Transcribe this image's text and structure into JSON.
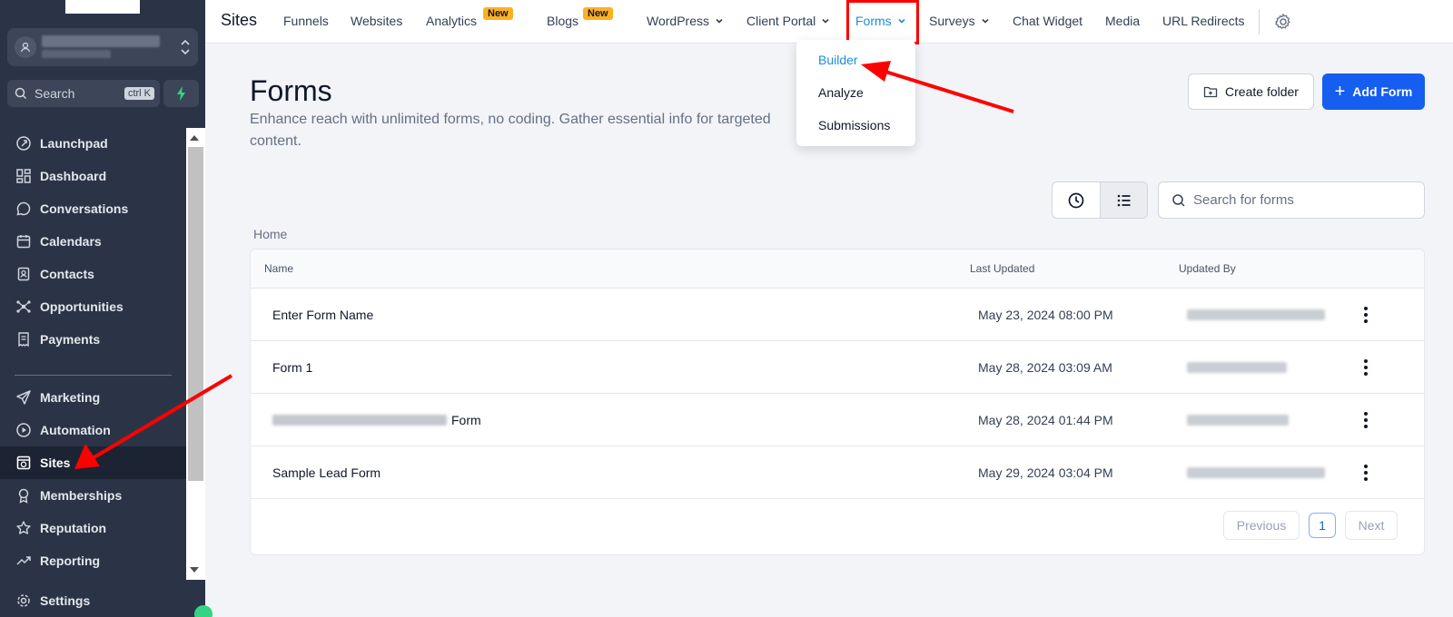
{
  "sidebar": {
    "search_label": "Search",
    "search_shortcut": "ctrl K",
    "items": [
      {
        "label": "Launchpad",
        "icon": "rocket-icon"
      },
      {
        "label": "Dashboard",
        "icon": "grid-icon"
      },
      {
        "label": "Conversations",
        "icon": "chat-bubble-icon"
      },
      {
        "label": "Calendars",
        "icon": "calendar-icon"
      },
      {
        "label": "Contacts",
        "icon": "contact-book-icon"
      },
      {
        "label": "Opportunities",
        "icon": "network-icon"
      },
      {
        "label": "Payments",
        "icon": "receipt-icon"
      },
      {
        "label": "Marketing",
        "icon": "send-icon"
      },
      {
        "label": "Automation",
        "icon": "play-circle-icon"
      },
      {
        "label": "Sites",
        "icon": "globe-window-icon"
      },
      {
        "label": "Memberships",
        "icon": "award-icon"
      },
      {
        "label": "Reputation",
        "icon": "star-icon"
      },
      {
        "label": "Reporting",
        "icon": "trend-up-icon"
      },
      {
        "label": "Settings",
        "icon": "gear-icon"
      }
    ],
    "active_item": "Sites"
  },
  "topbar": {
    "title": "Sites",
    "links": {
      "funnels": "Funnels",
      "websites": "Websites",
      "analytics": "Analytics",
      "blogs": "Blogs",
      "wordpress": "WordPress",
      "client_portal": "Client Portal",
      "forms": "Forms",
      "surveys": "Surveys",
      "chat_widget": "Chat Widget",
      "media": "Media",
      "url_redirects": "URL Redirects"
    },
    "new_badge": "New",
    "active_link": "Forms"
  },
  "forms_dropdown": {
    "items": [
      "Builder",
      "Analyze",
      "Submissions"
    ],
    "active_item": "Builder"
  },
  "main": {
    "title": "Forms",
    "description": "Enhance reach with unlimited forms, no coding. Gather essential info for targeted content.",
    "create_folder_label": "Create folder",
    "add_form_label": "Add Form",
    "search_placeholder": "Search for forms",
    "breadcrumb": "Home"
  },
  "table": {
    "columns": [
      "Name",
      "Last Updated",
      "Updated By"
    ],
    "rows": [
      {
        "name": "Enter Form Name",
        "last_updated": "May 23, 2024 08:00 PM"
      },
      {
        "name": "Form 1",
        "last_updated": "May 28, 2024 03:09 AM"
      },
      {
        "name": "Form",
        "last_updated": "May 28, 2024 01:44 PM"
      },
      {
        "name": "Sample Lead Form",
        "last_updated": "May 29, 2024 03:04 PM"
      }
    ]
  },
  "pagination": {
    "previous": "Previous",
    "current_page": "1",
    "next": "Next"
  },
  "colors": {
    "sidebar_bg": "#2b3446",
    "primary": "#155eef",
    "active_tab": "#1a8fd6",
    "highlight_red": "#ff0000",
    "badge_yellow": "#fdb022"
  }
}
